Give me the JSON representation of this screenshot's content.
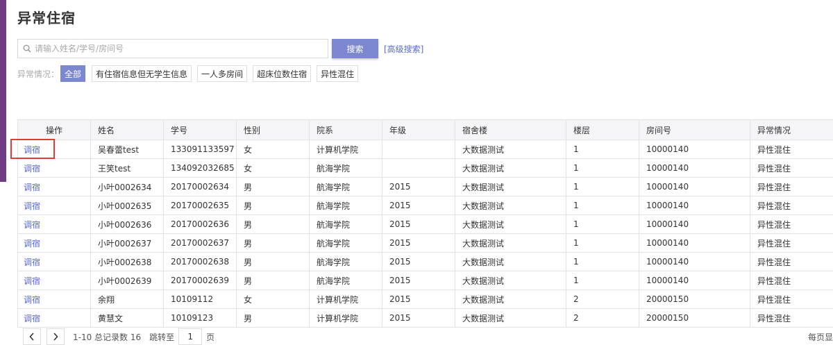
{
  "page": {
    "title": "异常住宿"
  },
  "search": {
    "placeholder": "请输入姓名/学号/房间号",
    "button_label": "搜索",
    "advanced_label": "[高级搜索]"
  },
  "filters": {
    "label": "异常情况：",
    "options": [
      "全部",
      "有住宿信息但无学生信息",
      "一人多房间",
      "超床位数住宿",
      "异性混住"
    ],
    "active": "全部"
  },
  "table": {
    "columns": [
      "操作",
      "姓名",
      "学号",
      "性别",
      "院系",
      "年级",
      "宿舍楼",
      "楼层",
      "房间号",
      "异常情况"
    ],
    "rows": [
      [
        "调宿",
        "吴春蕾test",
        "133091133597",
        "女",
        "计算机学院",
        "",
        "大数据测试",
        "1",
        "10000140",
        "异性混住"
      ],
      [
        "调宿",
        "王笑test",
        "134092032685",
        "女",
        "航海学院",
        "",
        "大数据测试",
        "1",
        "10000140",
        "异性混住"
      ],
      [
        "调宿",
        "小叶0002634",
        "20170002634",
        "男",
        "航海学院",
        "2015",
        "大数据测试",
        "1",
        "10000140",
        "异性混住"
      ],
      [
        "调宿",
        "小叶0002635",
        "20170002635",
        "男",
        "航海学院",
        "2015",
        "大数据测试",
        "1",
        "10000140",
        "异性混住"
      ],
      [
        "调宿",
        "小叶0002636",
        "20170002636",
        "男",
        "航海学院",
        "2015",
        "大数据测试",
        "1",
        "10000140",
        "异性混住"
      ],
      [
        "调宿",
        "小叶0002637",
        "20170002637",
        "男",
        "航海学院",
        "2015",
        "大数据测试",
        "1",
        "10000140",
        "异性混住"
      ],
      [
        "调宿",
        "小叶0002638",
        "20170002638",
        "男",
        "航海学院",
        "2015",
        "大数据测试",
        "1",
        "10000140",
        "异性混住"
      ],
      [
        "调宿",
        "小叶0002639",
        "20170002639",
        "男",
        "航海学院",
        "2015",
        "大数据测试",
        "1",
        "10000140",
        "异性混住"
      ],
      [
        "调宿",
        "余翔",
        "10109112",
        "女",
        "计算机学院",
        "2015",
        "大数据测试",
        "2",
        "20000150",
        "异性混住"
      ],
      [
        "调宿",
        "黄慧文",
        "10109123",
        "男",
        "计算机学院",
        "2015",
        "大数据测试",
        "2",
        "20000150",
        "异性混住"
      ]
    ]
  },
  "pagination": {
    "summary": "1-10 总记录数 16",
    "jump_label": "跳转至",
    "page_value": "1",
    "page_suffix": "页",
    "per_page_label": "每页显"
  },
  "colors": {
    "accent": "#7b87cf",
    "link": "#5a6bc6",
    "highlight": "#e03a3a",
    "side_strip": "#6f3c86"
  }
}
